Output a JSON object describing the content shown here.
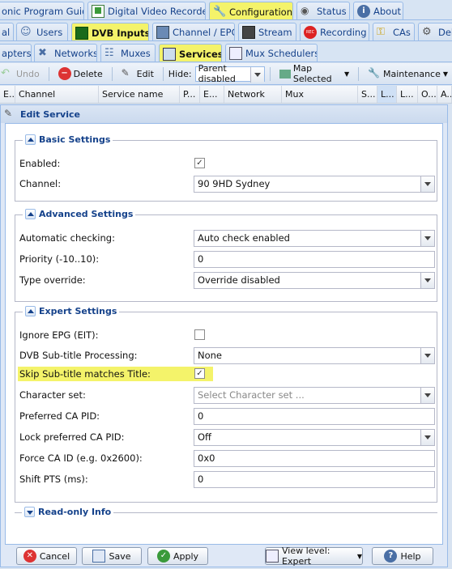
{
  "top_tabs": [
    {
      "label": "onic Program Guide",
      "icon": "guide-icon"
    },
    {
      "label": "Digital Video Recorder",
      "icon": "dvr-icon"
    },
    {
      "label": "Configuration",
      "icon": "wrench-icon",
      "active": true
    },
    {
      "label": "Status",
      "icon": "eye-icon"
    },
    {
      "label": "About",
      "icon": "info-icon"
    }
  ],
  "config_tabs": [
    {
      "label": "al"
    },
    {
      "label": "Users",
      "icon": "users-icon"
    },
    {
      "label": "DVB Inputs",
      "icon": "dvb-icon",
      "active": true
    },
    {
      "label": "Channel / EPG",
      "icon": "tv-icon"
    },
    {
      "label": "Stream",
      "icon": "stream-icon"
    },
    {
      "label": "Recording",
      "icon": "rec-icon"
    },
    {
      "label": "CAs",
      "icon": "key-icon"
    },
    {
      "label": "Deb",
      "icon": "debug-icon"
    }
  ],
  "dvb_tabs": [
    {
      "label": "apters"
    },
    {
      "label": "Networks",
      "icon": "network-icon"
    },
    {
      "label": "Muxes",
      "icon": "mux-icon"
    },
    {
      "label": "Services",
      "icon": "services-icon",
      "active": true
    },
    {
      "label": "Mux Schedulers",
      "icon": "scheduler-icon"
    }
  ],
  "toolbar": {
    "undo": "Undo",
    "delete": "Delete",
    "edit": "Edit",
    "hide_label": "Hide:",
    "hide_value": "Parent disabled",
    "map": "Map Selected",
    "maintenance": "Maintenance"
  },
  "grid_headers": [
    "E...",
    "Channel",
    "Service name",
    "P...",
    "E...",
    "Network",
    "Mux",
    "S...",
    "L...",
    "L...",
    "O...",
    "A..."
  ],
  "dialog": {
    "title": "Edit Service",
    "basic": {
      "legend": "Basic Settings",
      "enabled_label": "Enabled:",
      "enabled": "✓",
      "channel_label": "Channel:",
      "channel_value": "90 9HD Sydney"
    },
    "advanced": {
      "legend": "Advanced Settings",
      "autocheck_label": "Automatic checking:",
      "autocheck_value": "Auto check enabled",
      "priority_label": "Priority (-10..10):",
      "priority_value": "0",
      "type_label": "Type override:",
      "type_value": "Override disabled"
    },
    "expert": {
      "legend": "Expert Settings",
      "ignore_epg_label": "Ignore EPG (EIT):",
      "ignore_epg": "",
      "subtitle_label": "DVB Sub-title Processing:",
      "subtitle_value": "None",
      "skip_label": "Skip Sub-title matches Title:",
      "skip": "✓",
      "charset_label": "Character set:",
      "charset_placeholder": "Select Character set ...",
      "ca_pid_label": "Preferred CA PID:",
      "ca_pid_value": "0",
      "lock_ca_label": "Lock preferred CA PID:",
      "lock_ca_value": "Off",
      "force_ca_label": "Force CA ID (e.g. 0x2600):",
      "force_ca_value": "0x0",
      "shift_pts_label": "Shift PTS (ms):",
      "shift_pts_value": "0"
    },
    "readonly": {
      "legend": "Read-only Info"
    },
    "buttons": {
      "cancel": "Cancel",
      "save": "Save",
      "apply": "Apply",
      "view_level": "View level: Expert",
      "help": "Help"
    }
  },
  "colors": {
    "highlight": "#f4f36a",
    "accent": "#15428b"
  }
}
